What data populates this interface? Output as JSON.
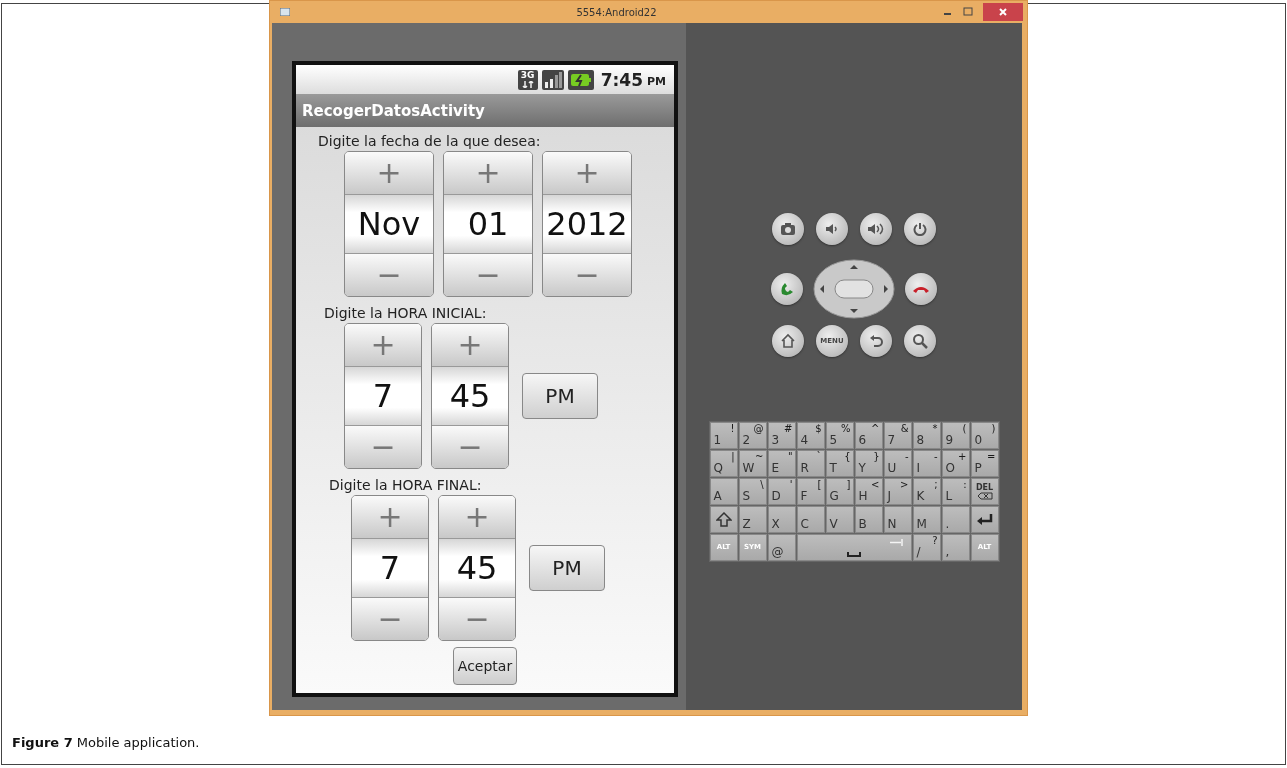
{
  "window": {
    "title": "5554:Android22"
  },
  "status_bar": {
    "network": "3G",
    "time": "7:45",
    "time_suffix": "PM"
  },
  "device_controls": {
    "menu_label": "MENU"
  },
  "app_bar": {
    "title": "RecogerDatosActivity"
  },
  "sections": [
    {
      "kind": "date",
      "label": "Digite la fecha de la que desea:",
      "pickers": [
        {
          "plus": "+",
          "value": "Nov",
          "minus": "−"
        },
        {
          "plus": "+",
          "value": "01",
          "minus": "−"
        },
        {
          "plus": "+",
          "value": "2012",
          "minus": "−"
        }
      ]
    },
    {
      "kind": "time",
      "label": "Digite la HORA INICIAL:",
      "pickers": [
        {
          "plus": "+",
          "value": "7",
          "minus": "−"
        },
        {
          "plus": "+",
          "value": "45",
          "minus": "−"
        }
      ],
      "ampm": "PM"
    },
    {
      "kind": "time",
      "label": "Digite la HORA FINAL:",
      "pickers": [
        {
          "plus": "+",
          "value": "7",
          "minus": "−"
        },
        {
          "plus": "+",
          "value": "45",
          "minus": "−"
        }
      ],
      "ampm": "PM"
    }
  ],
  "accept_button": "Aceptar",
  "keyboard": {
    "rows": [
      [
        {
          "kind": "char",
          "main": "1",
          "alt": "!"
        },
        {
          "kind": "char",
          "main": "2",
          "alt": "@"
        },
        {
          "kind": "char",
          "main": "3",
          "alt": "#"
        },
        {
          "kind": "char",
          "main": "4",
          "alt": "$"
        },
        {
          "kind": "char",
          "main": "5",
          "alt": "%"
        },
        {
          "kind": "char",
          "main": "6",
          "alt": "^"
        },
        {
          "kind": "char",
          "main": "7",
          "alt": "&"
        },
        {
          "kind": "char",
          "main": "8",
          "alt": "*"
        },
        {
          "kind": "char",
          "main": "9",
          "alt": "("
        },
        {
          "kind": "char",
          "main": "0",
          "alt": ")"
        }
      ],
      [
        {
          "kind": "char",
          "main": "Q",
          "alt": "|"
        },
        {
          "kind": "char",
          "main": "W",
          "alt": "~"
        },
        {
          "kind": "char",
          "main": "E",
          "alt": "\""
        },
        {
          "kind": "char",
          "main": "R",
          "alt": "`"
        },
        {
          "kind": "char",
          "main": "T",
          "alt": "{"
        },
        {
          "kind": "char",
          "main": "Y",
          "alt": "}"
        },
        {
          "kind": "char",
          "main": "U",
          "alt": "-"
        },
        {
          "kind": "char",
          "main": "I",
          "alt": "-"
        },
        {
          "kind": "char",
          "main": "O",
          "alt": "+"
        },
        {
          "kind": "char",
          "main": "P",
          "alt": "="
        }
      ],
      [
        {
          "kind": "char",
          "main": "A"
        },
        {
          "kind": "char",
          "main": "S",
          "alt": "\\"
        },
        {
          "kind": "char",
          "main": "D",
          "alt": "'"
        },
        {
          "kind": "char",
          "main": "F",
          "alt": "["
        },
        {
          "kind": "char",
          "main": "G",
          "alt": "]"
        },
        {
          "kind": "char",
          "main": "H",
          "alt": "<"
        },
        {
          "kind": "char",
          "main": "J",
          "alt": ">"
        },
        {
          "kind": "char",
          "main": "K",
          "alt": ";"
        },
        {
          "kind": "char",
          "main": "L",
          "alt": ":"
        },
        {
          "kind": "del",
          "main": "DEL"
        }
      ],
      [
        {
          "kind": "shift"
        },
        {
          "kind": "char",
          "main": "Z"
        },
        {
          "kind": "char",
          "main": "X"
        },
        {
          "kind": "char",
          "main": "C"
        },
        {
          "kind": "char",
          "main": "V"
        },
        {
          "kind": "char",
          "main": "B"
        },
        {
          "kind": "char",
          "main": "N"
        },
        {
          "kind": "char",
          "main": "M"
        },
        {
          "kind": "char",
          "main": "."
        },
        {
          "kind": "enter"
        }
      ],
      [
        {
          "kind": "label",
          "main": "ALT"
        },
        {
          "kind": "label",
          "main": "SYM"
        },
        {
          "kind": "char",
          "main": "@"
        },
        {
          "kind": "space",
          "colspan": 4
        },
        {
          "kind": "char",
          "main": "/",
          "alt": "?"
        },
        {
          "kind": "char",
          "main": ","
        },
        {
          "kind": "label",
          "main": "ALT"
        }
      ]
    ]
  },
  "caption": "**Figure 7** Mobile application."
}
